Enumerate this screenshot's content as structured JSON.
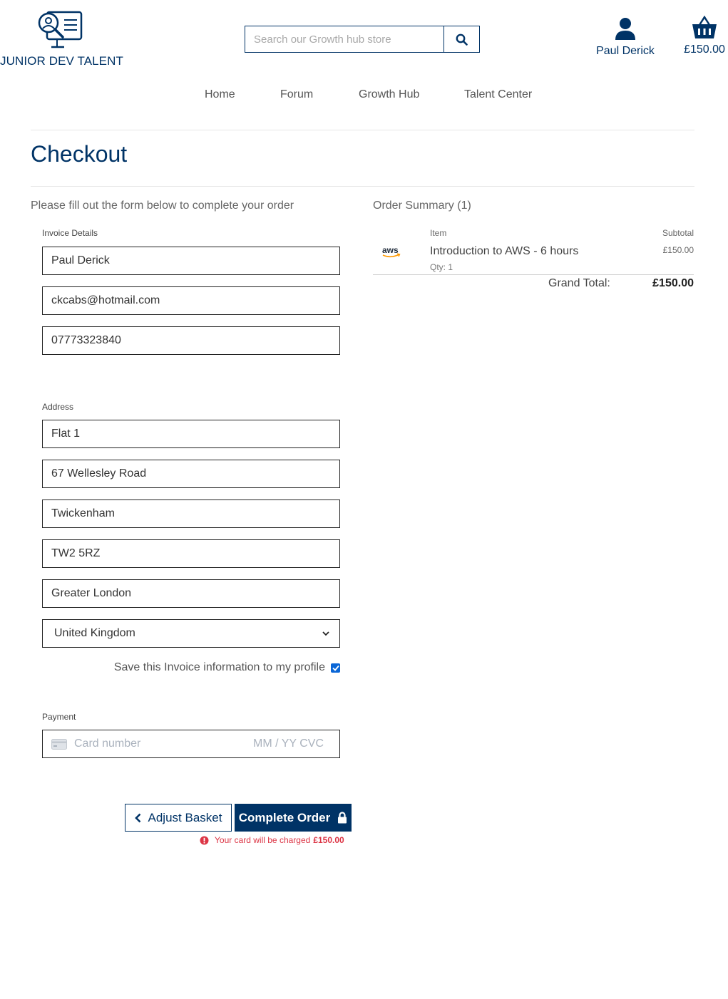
{
  "brand": {
    "name": "JUNIOR DEV TALENT"
  },
  "search": {
    "placeholder": "Search our Growth hub store",
    "icon": "search-icon"
  },
  "account": {
    "name": "Paul Derick",
    "icon": "user-icon"
  },
  "basket": {
    "total": "£150.00",
    "icon": "basket-icon"
  },
  "nav": {
    "items": [
      {
        "label": "Home"
      },
      {
        "label": "Forum"
      },
      {
        "label": "Growth Hub"
      },
      {
        "label": "Talent Center"
      }
    ]
  },
  "page": {
    "title": "Checkout",
    "lead": "Please fill out the form below to complete your order"
  },
  "invoice": {
    "section_label": "Invoice Details",
    "full_name": "Paul Derick",
    "email": "ckcabs@hotmail.com",
    "phone": "07773323840"
  },
  "address": {
    "section_label": "Address",
    "line1": "Flat 1",
    "line2": "67 Wellesley Road",
    "town": "Twickenham",
    "postcode": "TW2 5RZ",
    "county": "Greater London",
    "country": "United Kingdom"
  },
  "save_info": {
    "label": "Save this Invoice information to my profile",
    "checked": true
  },
  "payment": {
    "section_label": "Payment",
    "card_placeholder": "Card number",
    "expiry_cvc_placeholder": "MM / YY  CVC"
  },
  "actions": {
    "adjust_label": "Adjust Basket",
    "complete_label": "Complete Order",
    "charge_prefix": "Your card will be charged",
    "charge_amount": "£150.00"
  },
  "summary": {
    "title": "Order Summary (1)",
    "col_item": "Item",
    "col_subtotal": "Subtotal",
    "item": {
      "logo_text": "aws",
      "name": "Introduction to AWS - 6 hours",
      "qty": "Qty: 1",
      "subtotal": "£150.00"
    },
    "grand_label": "Grand Total:",
    "grand_value": "£150.00"
  },
  "colors": {
    "brand": "#003366",
    "error": "#dc3545",
    "checkbox": "#0a66d6"
  }
}
